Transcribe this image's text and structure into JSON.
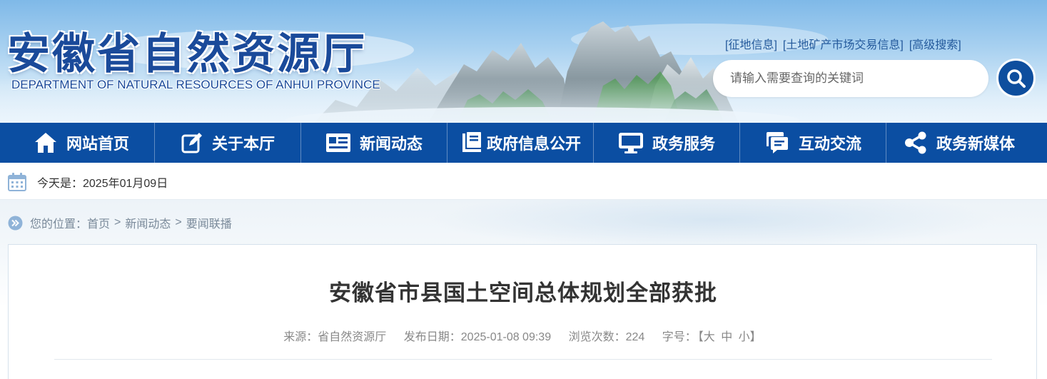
{
  "header": {
    "title_cn": "安徽省自然资源厅",
    "title_en": "DEPARTMENT OF NATURAL RESOURCES OF ANHUI PROVINCE",
    "top_links": [
      "[征地信息]",
      "[土地矿产市场交易信息]",
      "[高级搜索]"
    ],
    "search_placeholder": "请输入需要查询的关键词"
  },
  "nav": {
    "items": [
      {
        "label": "网站首页",
        "icon": "home-icon"
      },
      {
        "label": "关于本厅",
        "icon": "edit-icon"
      },
      {
        "label": "新闻动态",
        "icon": "newspaper-icon"
      },
      {
        "label": "政府信息公开",
        "icon": "book-icon"
      },
      {
        "label": "政务服务",
        "icon": "monitor-icon"
      },
      {
        "label": "互动交流",
        "icon": "chat-icon"
      },
      {
        "label": "政务新媒体",
        "icon": "share-icon"
      }
    ]
  },
  "datebar": {
    "text": "今天是：2025年01月09日"
  },
  "breadcrumb": {
    "prefix": "您的位置：",
    "items": [
      "首页",
      "新闻动态",
      "要闻联播"
    ],
    "separator": ">"
  },
  "article": {
    "title": "安徽省市县国土空间总体规划全部获批",
    "source": "来源：省自然资源厅",
    "publish_date": "发布日期：2025-01-08 09:39",
    "views": "浏览次数：224",
    "font_size_label": "字号：",
    "font_size_options": [
      "【大",
      "中",
      "小】"
    ]
  },
  "colors": {
    "nav_bg": "#0b4ea2",
    "brand_blue": "#1a4a9a",
    "search_button": "#0e4e9e"
  }
}
